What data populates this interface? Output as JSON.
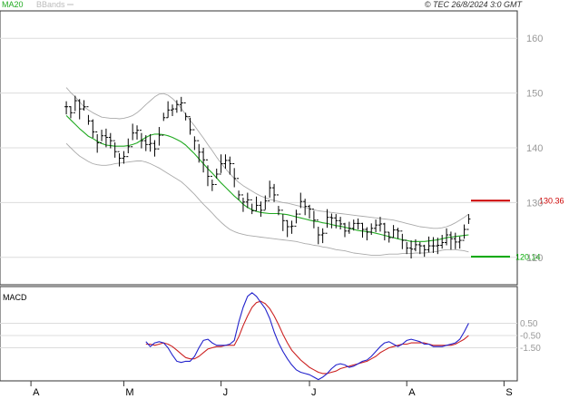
{
  "header": {
    "ma_legend": "MA20",
    "bb_legend": "BBands",
    "copyright": "© TEC 26/8/2024 3:0 GMT"
  },
  "colors": {
    "ma": "#22aa22",
    "bbands": "#aaaaaa",
    "price_bars": "#000000",
    "macd_line": "#2222cc",
    "signal_line": "#cc2222",
    "resistance": "#cc0000",
    "support": "#00aa00",
    "grid": "#dcdcdc",
    "axis_text": "#999999"
  },
  "chart_data": [
    {
      "type": "ohlc",
      "title": "",
      "ylim": [
        115,
        165
      ],
      "y_ticks": [
        120,
        130,
        140,
        150,
        160
      ],
      "y_tick_labels": [
        "120",
        "130",
        "140",
        "150",
        "160"
      ],
      "x_month_labels": [
        "A",
        "M",
        "J",
        "J",
        "A",
        "S"
      ],
      "x_month_index": [
        0,
        21,
        43,
        63,
        85,
        107
      ],
      "x_range": [
        -7,
        110
      ],
      "grid": true,
      "last_index": 99,
      "resistance": {
        "value": 130.36,
        "label": "130.36"
      },
      "support": {
        "value": 120.14,
        "label": "120.14"
      },
      "close": [
        147.5,
        146.4,
        148.6,
        147.1,
        147.5,
        144.9,
        142.9,
        140.9,
        142.2,
        141.9,
        141.3,
        139.3,
        138.1,
        138.4,
        140.2,
        142.7,
        143.2,
        141.3,
        140.6,
        140.8,
        139.8,
        142.3,
        145.5,
        146.9,
        147.1,
        147.9,
        148.2,
        145.7,
        143.3,
        141.3,
        139.2,
        137.8,
        134.8,
        133.3,
        135.2,
        137.1,
        137.7,
        137.1,
        134.4,
        131.4,
        130.1,
        130.5,
        128.5,
        129.5,
        128.6,
        130.3,
        132.7,
        131.4,
        128.6,
        126.7,
        125.6,
        125.7,
        127.9,
        130.2,
        129.3,
        128.8,
        126.8,
        124.1,
        124.4,
        127.3,
        127.2,
        126.7,
        126.1,
        124.8,
        125.3,
        126.2,
        126.2,
        125.1,
        124.6,
        125.3,
        125.9,
        126.1,
        124.6,
        123.6,
        125.0,
        124.8,
        123.1,
        121.7,
        121.5,
        122.3,
        122.1,
        121.4,
        122.1,
        122.1,
        122.2,
        122.7,
        124.1,
        123.4,
        122.8,
        123.1,
        125.1,
        127.0
      ],
      "high": [
        148.5,
        147.6,
        149.5,
        148.9,
        148.7,
        146.0,
        145.2,
        142.5,
        143.3,
        143.5,
        142.7,
        141.0,
        139.0,
        139.4,
        141.7,
        144.4,
        144.1,
        142.7,
        142.3,
        142.5,
        141.4,
        143.8,
        146.4,
        148.5,
        147.9,
        148.7,
        149.3,
        146.4,
        145.5,
        142.1,
        140.7,
        140.0,
        136.8,
        134.2,
        136.2,
        138.8,
        138.8,
        138.4,
        136.3,
        132.2,
        130.9,
        131.8,
        129.8,
        131.1,
        130.2,
        131.3,
        134.0,
        133.4,
        129.4,
        127.9,
        126.8,
        126.7,
        128.7,
        131.8,
        130.7,
        129.6,
        128.5,
        125.6,
        125.3,
        128.8,
        128.0,
        127.9,
        127.4,
        126.3,
        126.5,
        126.9,
        127.1,
        126.3,
        125.5,
        126.2,
        126.9,
        127.4,
        126.3,
        124.6,
        125.9,
        125.4,
        124.3,
        122.8,
        123.1,
        123.3,
        122.8,
        122.3,
        123.8,
        123.7,
        123.6,
        124.1,
        125.3,
        124.7,
        124.5,
        123.8,
        126.0,
        127.9
      ],
      "low": [
        146.1,
        145.4,
        146.7,
        145.2,
        146.8,
        144.2,
        141.8,
        139.1,
        141.2,
        140.1,
        139.9,
        138.2,
        136.6,
        137.1,
        139.0,
        141.4,
        141.5,
        139.9,
        139.4,
        139.3,
        138.4,
        140.4,
        144.9,
        145.5,
        145.8,
        146.4,
        146.6,
        145.0,
        142.4,
        139.6,
        137.3,
        135.5,
        133.0,
        132.1,
        134.4,
        135.4,
        136.2,
        135.1,
        132.8,
        130.5,
        128.3,
        129.0,
        127.9,
        128.5,
        127.4,
        128.7,
        130.9,
        130.1,
        127.7,
        124.8,
        123.7,
        124.3,
        126.2,
        129.0,
        127.7,
        127.1,
        125.3,
        122.4,
        122.6,
        125.4,
        125.3,
        125.3,
        125.1,
        123.7,
        124.3,
        124.9,
        125.1,
        123.6,
        123.1,
        124.1,
        124.6,
        124.7,
        123.1,
        122.7,
        123.6,
        123.4,
        121.5,
        120.6,
        119.8,
        121.1,
        120.6,
        120.1,
        120.9,
        120.8,
        120.6,
        121.6,
        122.2,
        121.4,
        121.5,
        121.6,
        123.4,
        126.1
      ],
      "ma20": [
        145.9,
        145.1,
        144.3,
        143.5,
        142.8,
        142.1,
        141.7,
        141.2,
        140.8,
        140.5,
        140.4,
        140.3,
        140.3,
        140.3,
        140.4,
        140.6,
        140.9,
        141.4,
        141.9,
        142.3,
        142.5,
        142.5,
        142.4,
        142.2,
        141.9,
        141.5,
        141.1,
        140.5,
        139.7,
        138.9,
        138.0,
        137.1,
        136.2,
        135.4,
        134.5,
        133.6,
        132.8,
        132.0,
        131.2,
        130.5,
        129.7,
        129.1,
        128.7,
        128.4,
        128.2,
        128.1,
        128.0,
        128.0,
        128.0,
        127.9,
        127.8,
        127.6,
        127.4,
        127.2,
        127.0,
        126.8,
        126.6,
        126.5,
        126.3,
        126.2,
        126.0,
        125.8,
        125.7,
        125.5,
        125.3,
        125.1,
        124.9,
        124.8,
        124.7,
        124.6,
        124.4,
        124.2,
        124.0,
        123.8,
        123.6,
        123.4,
        123.2,
        123.1,
        122.9,
        122.9,
        122.9,
        122.9,
        123.0,
        123.1,
        123.2,
        123.4,
        123.6,
        123.7,
        123.8,
        123.9,
        124.0,
        124.1
      ],
      "bb_upper": [
        151.0,
        150.1,
        149.3,
        148.4,
        147.5,
        146.9,
        146.4,
        146.0,
        145.6,
        145.5,
        145.4,
        145.4,
        145.3,
        145.4,
        145.6,
        145.9,
        146.4,
        147.1,
        147.9,
        148.6,
        149.3,
        149.8,
        149.9,
        149.6,
        149.0,
        148.2,
        147.2,
        146.1,
        145.0,
        144.0,
        142.9,
        141.8,
        140.6,
        139.5,
        138.3,
        137.2,
        136.2,
        135.3,
        134.4,
        133.7,
        133.1,
        132.6,
        132.1,
        131.6,
        131.2,
        130.9,
        130.6,
        130.4,
        130.2,
        130.0,
        129.9,
        129.7,
        129.5,
        129.3,
        129.1,
        128.9,
        128.7,
        128.5,
        128.4,
        128.3,
        128.2,
        128.1,
        128.0,
        127.9,
        127.8,
        127.7,
        127.6,
        127.5,
        127.4,
        127.3,
        127.2,
        127.1,
        127.0,
        126.9,
        126.8,
        126.6,
        126.4,
        126.2,
        126.0,
        125.8,
        125.6,
        125.5,
        125.4,
        125.3,
        125.3,
        125.4,
        125.6,
        125.9,
        126.3,
        126.8,
        127.3,
        127.9
      ],
      "bb_lower": [
        140.8,
        140.0,
        139.2,
        138.5,
        138.0,
        137.5,
        137.1,
        136.9,
        136.8,
        136.8,
        136.9,
        137.1,
        137.2,
        137.3,
        137.4,
        137.5,
        137.6,
        137.6,
        137.4,
        137.1,
        136.7,
        136.3,
        135.8,
        135.3,
        134.8,
        134.3,
        133.8,
        133.1,
        132.3,
        131.5,
        130.6,
        129.7,
        128.9,
        128.1,
        127.2,
        126.4,
        125.7,
        125.1,
        124.7,
        124.4,
        124.2,
        124.0,
        123.9,
        123.8,
        123.7,
        123.6,
        123.5,
        123.4,
        123.3,
        123.2,
        123.1,
        123.0,
        122.9,
        122.7,
        122.5,
        122.4,
        122.2,
        122.1,
        121.9,
        121.8,
        121.6,
        121.4,
        121.3,
        121.2,
        121.0,
        120.8,
        120.7,
        120.6,
        120.5,
        120.4,
        120.4,
        120.4,
        120.5,
        120.6,
        120.6,
        120.6,
        120.7,
        120.7,
        120.7,
        120.8,
        120.8,
        120.8,
        120.9,
        121.0,
        121.1,
        121.3,
        121.4,
        121.4,
        121.4,
        121.3,
        121.2,
        121.0
      ]
    },
    {
      "type": "line",
      "title": "MACD",
      "ylim": [
        -4.2,
        3.5
      ],
      "y_ticks": [
        0.5,
        -0.5,
        -1.5
      ],
      "y_tick_labels": [
        "0.50",
        "-0.50",
        "-1.50"
      ],
      "series": [
        {
          "values": [
            -1.0,
            -1.4,
            -1.1,
            -1.0,
            -1.1,
            -1.5,
            -2.1,
            -2.6,
            -2.7,
            -2.6,
            -2.6,
            -2.2,
            -1.5,
            -0.9,
            -0.8,
            -1.1,
            -1.3,
            -1.3,
            -1.3,
            -1.2,
            -0.9,
            0.6,
            1.8,
            2.7,
            3.0,
            2.7,
            2.2,
            1.7,
            0.9,
            -0.2,
            -1.1,
            -1.8,
            -2.4,
            -2.9,
            -3.3,
            -3.5,
            -3.6,
            -3.7,
            -3.9,
            -4.1,
            -3.9,
            -3.6,
            -3.2,
            -2.9,
            -2.8,
            -2.9,
            -3.1,
            -3.0,
            -2.8,
            -2.6,
            -2.5,
            -2.2,
            -1.8,
            -1.4,
            -1.1,
            -1.0,
            -1.2,
            -1.4,
            -1.2,
            -0.9,
            -0.8,
            -0.9,
            -1.0,
            -1.2,
            -1.2,
            -1.4,
            -1.4,
            -1.4,
            -1.3,
            -1.2,
            -1.1,
            -0.8,
            -0.2,
            0.5
          ]
        },
        {
          "values": [
            -1.2,
            -1.2,
            -1.3,
            -1.2,
            -1.1,
            -1.2,
            -1.4,
            -1.7,
            -2.0,
            -2.3,
            -2.4,
            -2.4,
            -2.2,
            -1.9,
            -1.6,
            -1.5,
            -1.4,
            -1.4,
            -1.3,
            -1.3,
            -1.3,
            -0.6,
            0.3,
            1.1,
            1.8,
            2.2,
            2.3,
            2.1,
            1.7,
            1.1,
            0.4,
            -0.4,
            -1.1,
            -1.7,
            -2.1,
            -2.5,
            -2.8,
            -3.1,
            -3.3,
            -3.5,
            -3.6,
            -3.6,
            -3.5,
            -3.4,
            -3.2,
            -3.1,
            -3.0,
            -2.9,
            -2.8,
            -2.7,
            -2.6,
            -2.4,
            -2.2,
            -1.9,
            -1.7,
            -1.5,
            -1.4,
            -1.3,
            -1.2,
            -1.2,
            -1.1,
            -1.1,
            -1.1,
            -1.1,
            -1.2,
            -1.3,
            -1.3,
            -1.3,
            -1.3,
            -1.3,
            -1.2,
            -1.0,
            -0.8,
            -0.5
          ]
        }
      ]
    }
  ]
}
